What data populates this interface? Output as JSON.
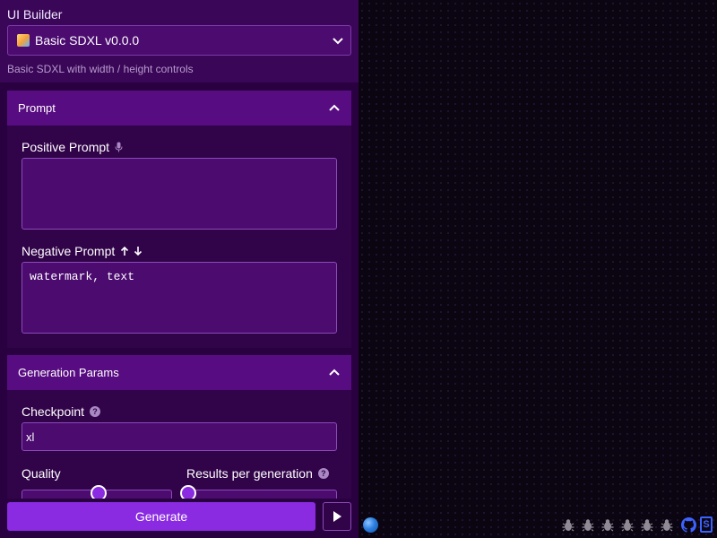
{
  "header": {
    "title": "UI Builder",
    "selected_ui": "Basic SDXL v0.0.0",
    "description": "Basic SDXL with width / height controls"
  },
  "prompt_section": {
    "title": "Prompt",
    "positive_label": "Positive Prompt",
    "positive_value": "",
    "negative_label": "Negative Prompt",
    "negative_value": "watermark, text"
  },
  "params_section": {
    "title": "Generation Params",
    "checkpoint_label": "Checkpoint",
    "checkpoint_value": "xl",
    "quality_label": "Quality",
    "quality_level": 0.5,
    "results_label": "Results per generation",
    "results_level": 0.0
  },
  "footer": {
    "generate_label": "Generate"
  },
  "icons": {
    "mic": "microphone-icon",
    "sort": "arrow-up-down-icon",
    "help": "question-icon",
    "collapse": "chevron-up-icon",
    "play": "play-icon",
    "bug": "bug-icon",
    "github": "github-icon",
    "discord": "discord-icon"
  },
  "colors": {
    "accent": "#8a2be2",
    "panel": "#2a0140",
    "section_header": "#580c82",
    "input_bg": "#4b0b6f",
    "canvas": "#0b0512"
  }
}
